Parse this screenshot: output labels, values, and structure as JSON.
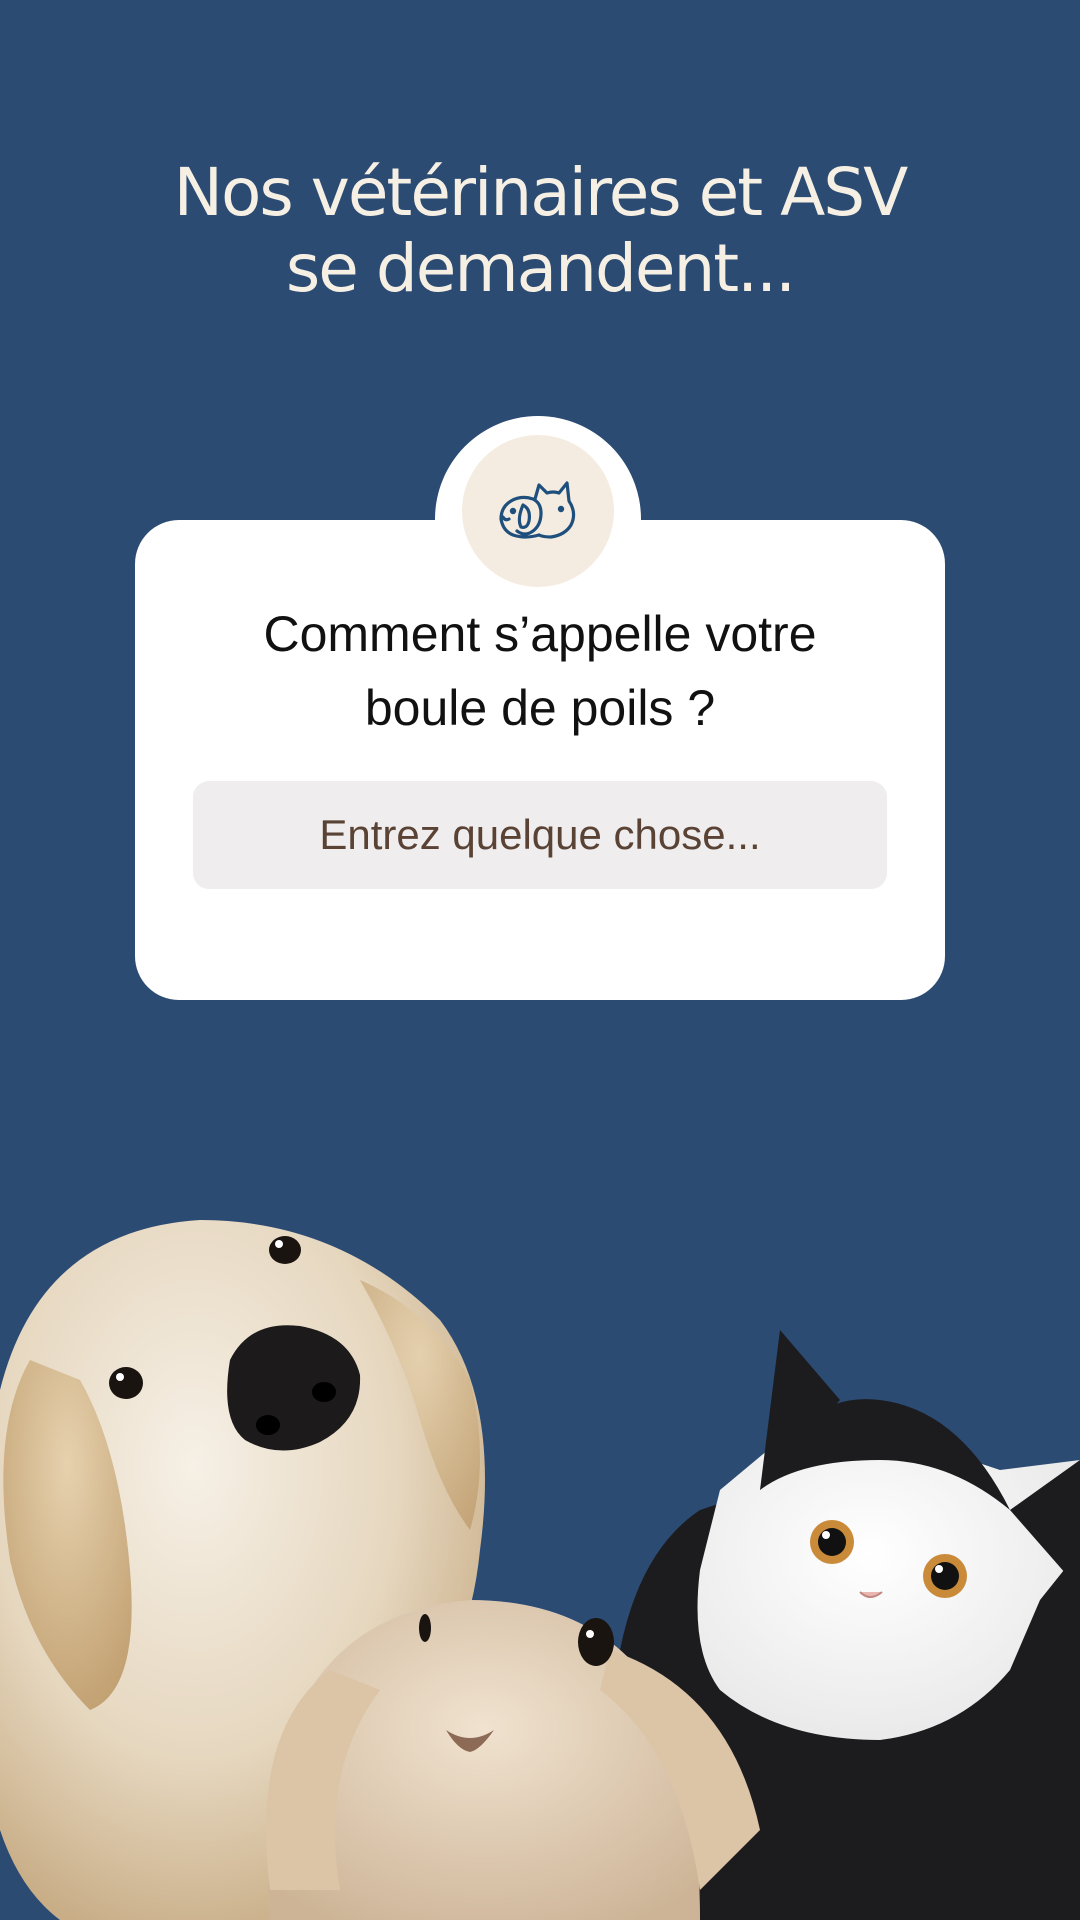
{
  "headline": {
    "line1": "Nos vétérinaires et ASV",
    "line2": "se demandent..."
  },
  "card": {
    "badge_icon": "dog-cat-icon",
    "question_line1": "Comment s’appelle votre",
    "question_line2": "boule de poils ?",
    "input_placeholder": "Entrez quelque chose...",
    "input_value": ""
  },
  "photo": {
    "subject": "pets-photo",
    "animals": [
      "dog",
      "rabbit",
      "cat"
    ]
  },
  "colors": {
    "background": "#2b4b73",
    "headline_text": "#f6efe4",
    "card": "#ffffff",
    "badge": "#f4ece0",
    "icon": "#1f4f7c",
    "input_bg": "#efedee",
    "input_text": "#5a4335"
  }
}
